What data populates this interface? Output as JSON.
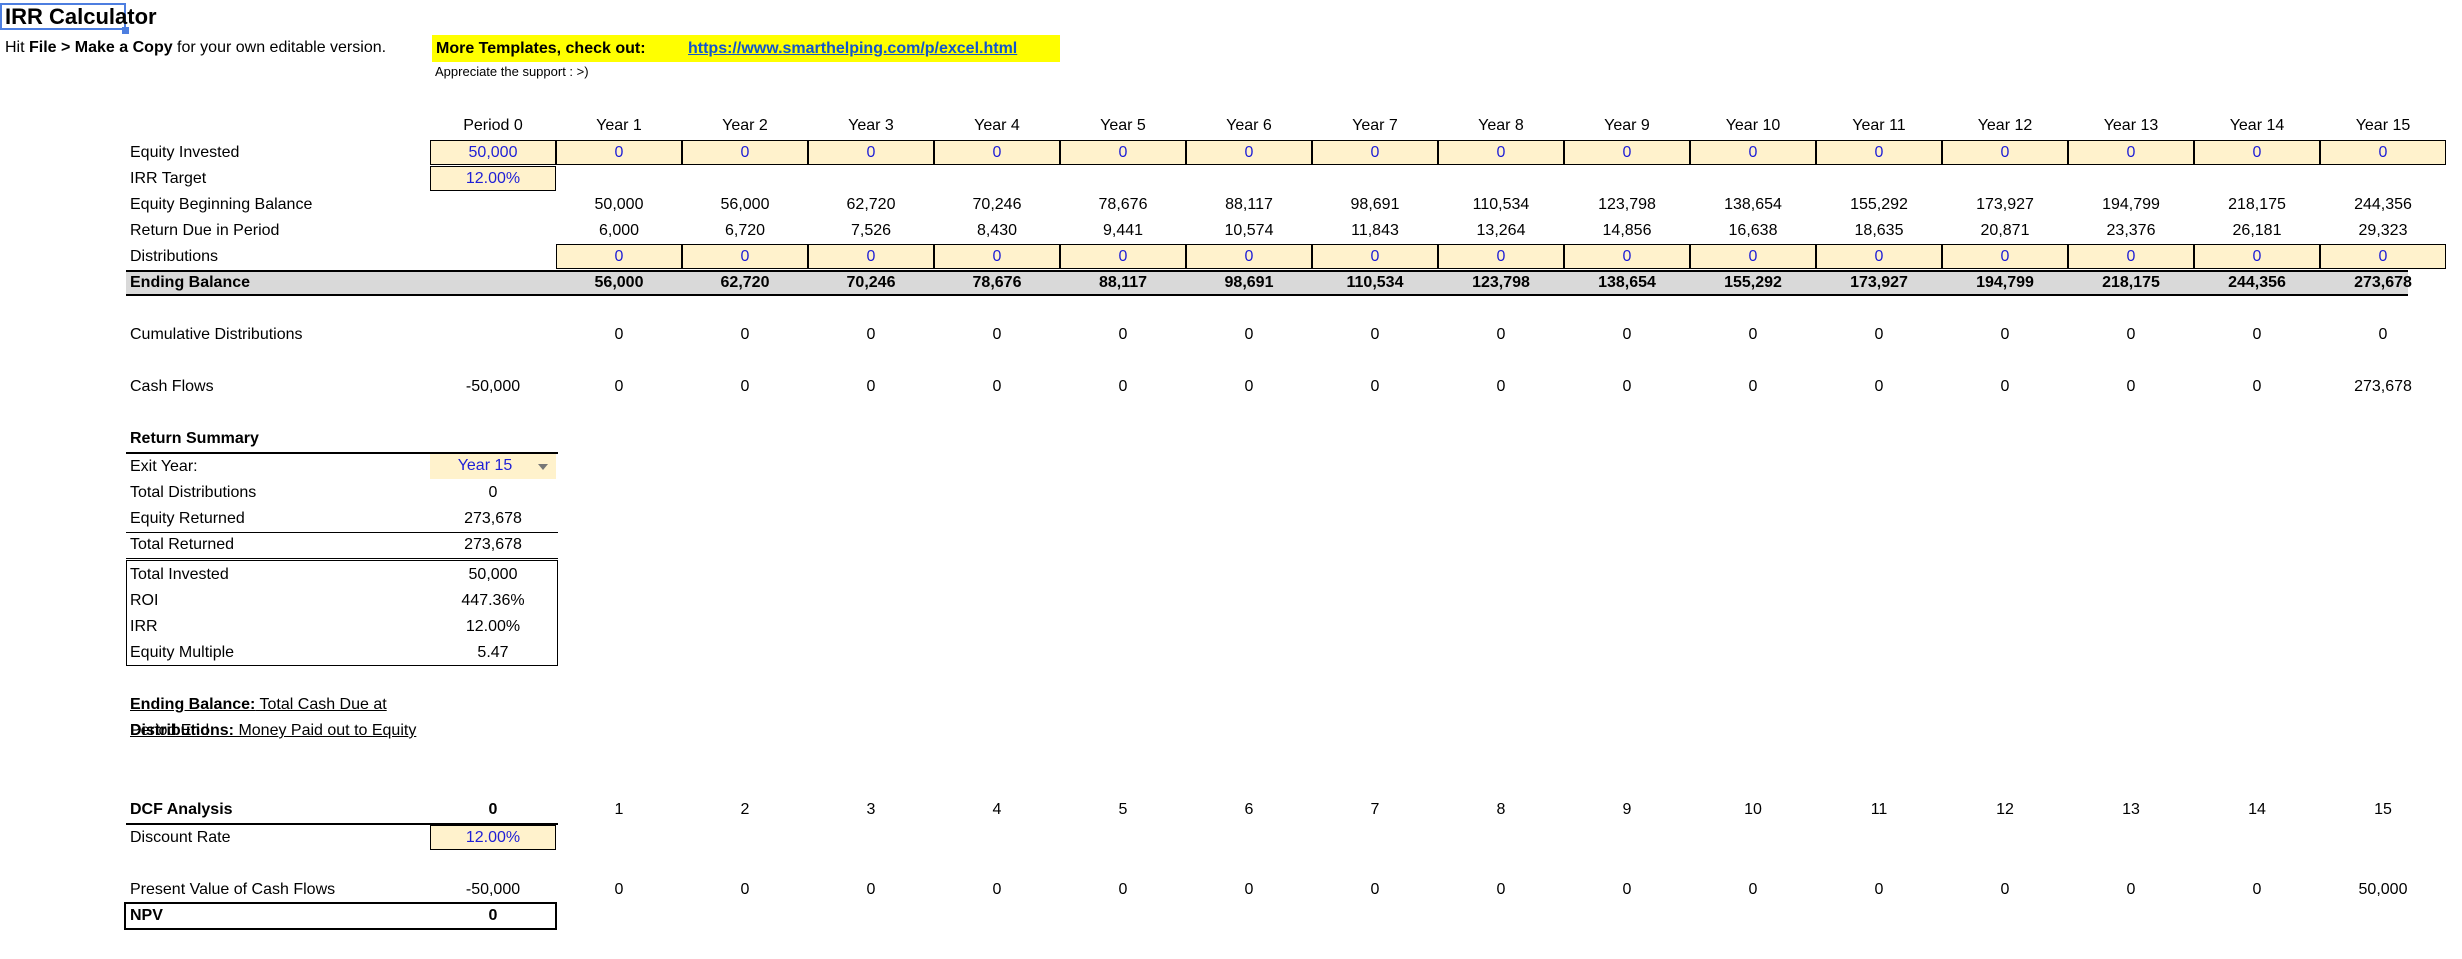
{
  "sheet": {
    "title": "IRR Calculator",
    "hint": {
      "pre": "Hit ",
      "file": "File",
      "arrow": " > ",
      "copy": "Make a Copy",
      "post": " for your own editable version."
    },
    "promo": {
      "label": "More Templates, check out:",
      "link": "https://www.smarthelping.com/p/excel.html"
    },
    "support": "Appreciate the support : >)"
  },
  "periods": [
    "Period 0",
    "Year 1",
    "Year 2",
    "Year 3",
    "Year 4",
    "Year 5",
    "Year 6",
    "Year 7",
    "Year 8",
    "Year 9",
    "Year 10",
    "Year 11",
    "Year 12",
    "Year 13",
    "Year 14",
    "Year 15"
  ],
  "rows": {
    "equity_invested": {
      "label": "Equity Invested",
      "values": [
        "50,000",
        "0",
        "0",
        "0",
        "0",
        "0",
        "0",
        "0",
        "0",
        "0",
        "0",
        "0",
        "0",
        "0",
        "0",
        "0"
      ]
    },
    "irr_target": {
      "label": "IRR Target",
      "value": "12.00%"
    },
    "equity_beginning": {
      "label": "Equity Beginning Balance",
      "values": [
        "",
        "50,000",
        "56,000",
        "62,720",
        "70,246",
        "78,676",
        "88,117",
        "98,691",
        "110,534",
        "123,798",
        "138,654",
        "155,292",
        "173,927",
        "194,799",
        "218,175",
        "244,356"
      ]
    },
    "return_due": {
      "label": "Return Due in Period",
      "values": [
        "",
        "6,000",
        "6,720",
        "7,526",
        "8,430",
        "9,441",
        "10,574",
        "11,843",
        "13,264",
        "14,856",
        "16,638",
        "18,635",
        "20,871",
        "23,376",
        "26,181",
        "29,323"
      ]
    },
    "distributions": {
      "label": "Distributions",
      "values": [
        "",
        "0",
        "0",
        "0",
        "0",
        "0",
        "0",
        "0",
        "0",
        "0",
        "0",
        "0",
        "0",
        "0",
        "0",
        "0"
      ]
    },
    "ending_balance": {
      "label": "Ending Balance",
      "values": [
        "",
        "56,000",
        "62,720",
        "70,246",
        "78,676",
        "88,117",
        "98,691",
        "110,534",
        "123,798",
        "138,654",
        "155,292",
        "173,927",
        "194,799",
        "218,175",
        "244,356",
        "273,678"
      ]
    },
    "cumulative": {
      "label": "Cumulative Distributions",
      "values": [
        "",
        "0",
        "0",
        "0",
        "0",
        "0",
        "0",
        "0",
        "0",
        "0",
        "0",
        "0",
        "0",
        "0",
        "0",
        "0"
      ]
    },
    "cash_flows": {
      "label": "Cash Flows",
      "values": [
        "-50,000",
        "0",
        "0",
        "0",
        "0",
        "0",
        "0",
        "0",
        "0",
        "0",
        "0",
        "0",
        "0",
        "0",
        "0",
        "273,678"
      ]
    }
  },
  "summary": {
    "header": "Return Summary",
    "exit_year": {
      "label": "Exit Year:",
      "value": "Year 15"
    },
    "total_distributions": {
      "label": "Total Distributions",
      "value": "0"
    },
    "equity_returned": {
      "label": "Equity Returned",
      "value": "273,678"
    },
    "total_returned": {
      "label": "Total Returned",
      "value": "273,678"
    },
    "total_invested": {
      "label": "Total Invested",
      "value": "50,000"
    },
    "roi": {
      "label": "ROI",
      "value": "447.36%"
    },
    "irr": {
      "label": "IRR",
      "value": "12.00%"
    },
    "equity_multiple": {
      "label": "Equity Multiple",
      "value": "5.47"
    }
  },
  "notes": {
    "ending_term": "Ending Balance:",
    "ending_def": " Total Cash Due at Period End",
    "dist_term": "Distributions:",
    "dist_def": " Money Paid out to Equity"
  },
  "dcf": {
    "header": "DCF Analysis",
    "periods": [
      "0",
      "1",
      "2",
      "3",
      "4",
      "5",
      "6",
      "7",
      "8",
      "9",
      "10",
      "11",
      "12",
      "13",
      "14",
      "15"
    ],
    "discount_rate": {
      "label": "Discount Rate",
      "value": "12.00%"
    },
    "pv": {
      "label": "Present Value of Cash Flows",
      "values": [
        "-50,000",
        "0",
        "0",
        "0",
        "0",
        "0",
        "0",
        "0",
        "0",
        "0",
        "0",
        "0",
        "0",
        "0",
        "0",
        "50,000"
      ]
    },
    "npv": {
      "label": "NPV",
      "value": "0"
    }
  }
}
